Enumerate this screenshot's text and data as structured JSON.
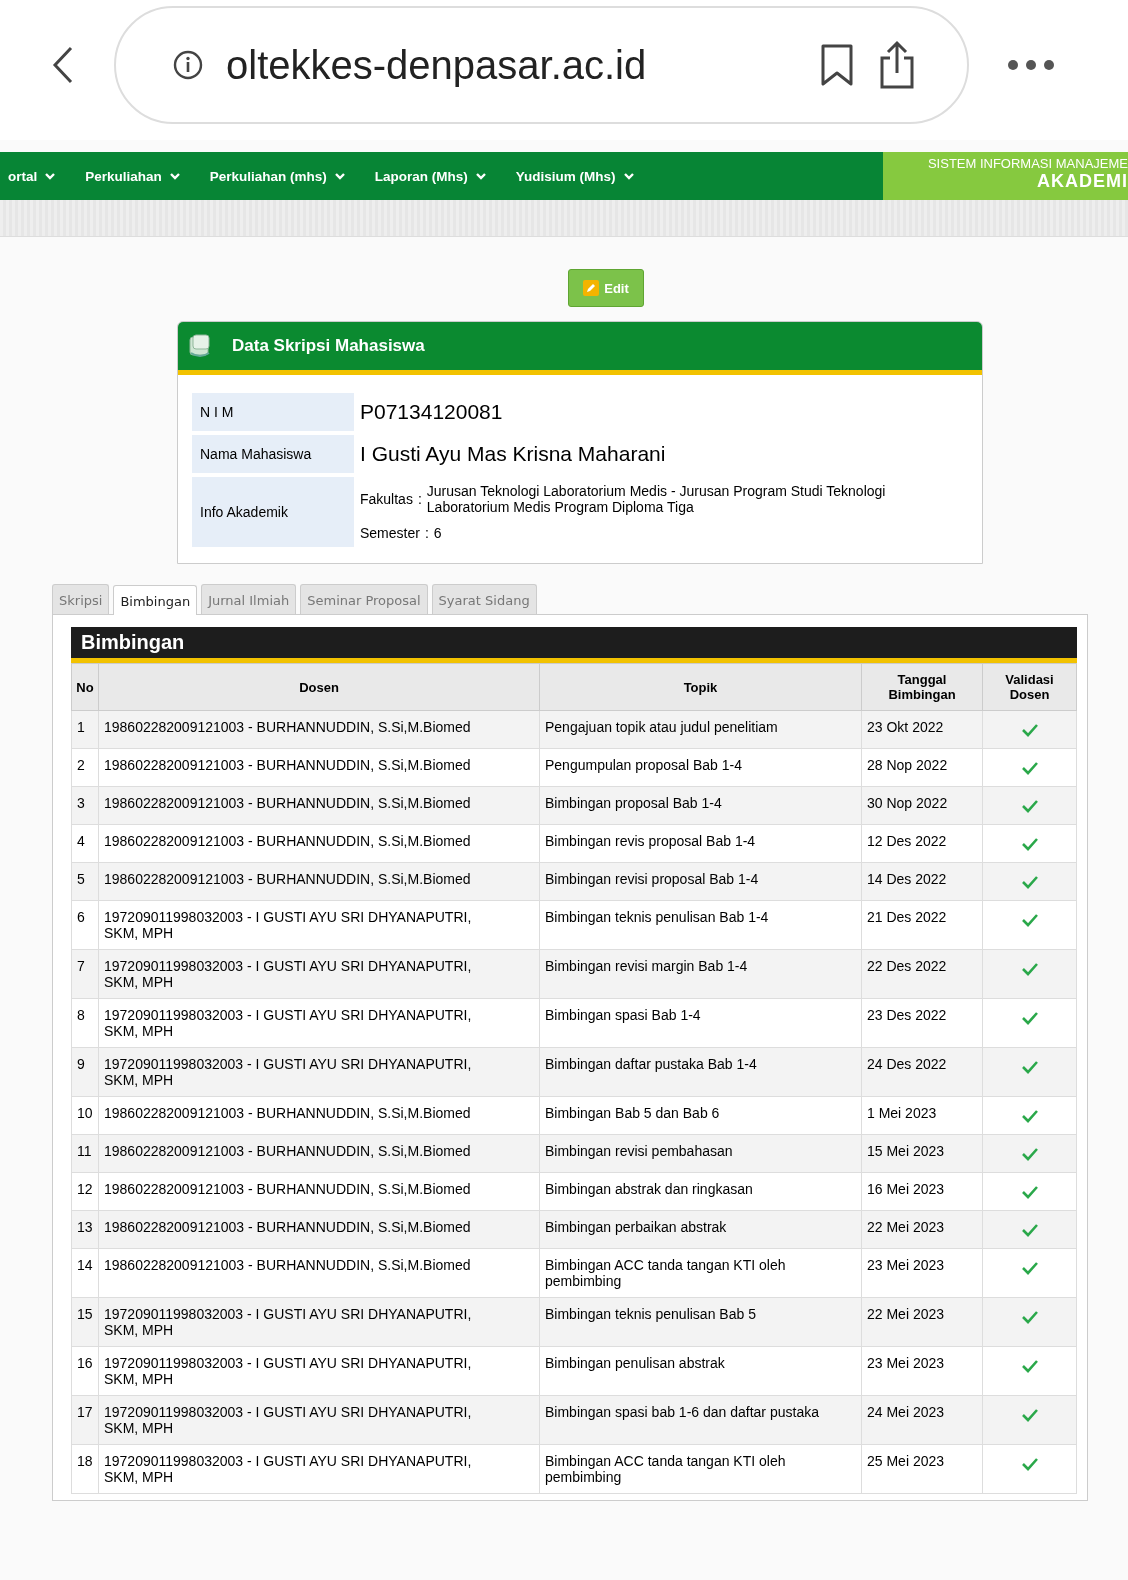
{
  "browser": {
    "url": "oltekkes-denpasar.ac.id"
  },
  "nav": {
    "items": [
      "ortal",
      "Perkuliahan",
      "Perkuliahan (mhs)",
      "Laporan (Mhs)",
      "Yudisium (Mhs)"
    ],
    "logo_top": "SISTEM INFORMASI MANAJEME",
    "logo_bottom": "AKADEMI"
  },
  "edit_button": "Edit",
  "card": {
    "title": "Data Skripsi Mahasiswa",
    "nim_label": "N I M",
    "nim": "P07134120081",
    "name_label": "Nama Mahasiswa",
    "name": "I Gusti Ayu Mas Krisna Maharani",
    "info_label": "Info Akademik",
    "fakultas_label": "Fakultas",
    "fakultas_sep": ":",
    "fakultas": "Jurusan Teknologi Laboratorium Medis - Jurusan Program Studi Teknologi Laboratorium Medis Program Diploma Tiga",
    "semester_label": "Semester",
    "semester_sep": ":",
    "semester": "6"
  },
  "tabs": [
    {
      "label": "Skripsi",
      "selected": false
    },
    {
      "label": "Bimbingan",
      "selected": true
    },
    {
      "label": "Jurnal Ilmiah",
      "selected": false
    },
    {
      "label": "Seminar Proposal",
      "selected": false
    },
    {
      "label": "Syarat Sidang",
      "selected": false
    }
  ],
  "table": {
    "title": "Bimbingan",
    "columns": [
      "No",
      "Dosen",
      "Topik",
      "Tanggal Bimbingan",
      "Validasi Dosen"
    ],
    "rows": [
      {
        "no": "1",
        "dosen": "198602282009121003 - BURHANNUDDIN, S.Si,M.Biomed",
        "topik": "Pengajuan topik atau judul penelitiam",
        "tanggal": "23 Okt 2022",
        "validated": true
      },
      {
        "no": "2",
        "dosen": "198602282009121003 - BURHANNUDDIN, S.Si,M.Biomed",
        "topik": "Pengumpulan proposal Bab 1-4",
        "tanggal": "28 Nop 2022",
        "validated": true
      },
      {
        "no": "3",
        "dosen": "198602282009121003 - BURHANNUDDIN, S.Si,M.Biomed",
        "topik": "Bimbingan proposal Bab 1-4",
        "tanggal": "30 Nop 2022",
        "validated": true
      },
      {
        "no": "4",
        "dosen": "198602282009121003 - BURHANNUDDIN, S.Si,M.Biomed",
        "topik": "Bimbingan revis proposal Bab 1-4",
        "tanggal": "12 Des 2022",
        "validated": true
      },
      {
        "no": "5",
        "dosen": "198602282009121003 - BURHANNUDDIN, S.Si,M.Biomed",
        "topik": "Bimbingan revisi proposal Bab 1-4",
        "tanggal": "14 Des 2022",
        "validated": true
      },
      {
        "no": "6",
        "dosen": "197209011998032003 - I GUSTI AYU SRI DHYANAPUTRI, SKM, MPH",
        "topik": "Bimbingan teknis penulisan Bab 1-4",
        "tanggal": "21 Des 2022",
        "validated": true
      },
      {
        "no": "7",
        "dosen": "197209011998032003 - I GUSTI AYU SRI DHYANAPUTRI, SKM, MPH",
        "topik": "Bimbingan revisi margin Bab 1-4",
        "tanggal": "22 Des 2022",
        "validated": true
      },
      {
        "no": "8",
        "dosen": "197209011998032003 - I GUSTI AYU SRI DHYANAPUTRI, SKM, MPH",
        "topik": "Bimbingan spasi Bab 1-4",
        "tanggal": "23 Des 2022",
        "validated": true
      },
      {
        "no": "9",
        "dosen": "197209011998032003 - I GUSTI AYU SRI DHYANAPUTRI, SKM, MPH",
        "topik": "Bimbingan daftar pustaka Bab 1-4",
        "tanggal": "24 Des 2022",
        "validated": true
      },
      {
        "no": "10",
        "dosen": "198602282009121003 - BURHANNUDDIN, S.Si,M.Biomed",
        "topik": "Bimbingan Bab 5 dan Bab 6",
        "tanggal": "1 Mei 2023",
        "validated": true
      },
      {
        "no": "11",
        "dosen": "198602282009121003 - BURHANNUDDIN, S.Si,M.Biomed",
        "topik": "Bimbingan revisi pembahasan",
        "tanggal": "15 Mei 2023",
        "validated": true
      },
      {
        "no": "12",
        "dosen": "198602282009121003 - BURHANNUDDIN, S.Si,M.Biomed",
        "topik": "Bimbingan abstrak dan ringkasan",
        "tanggal": "16 Mei 2023",
        "validated": true
      },
      {
        "no": "13",
        "dosen": "198602282009121003 - BURHANNUDDIN, S.Si,M.Biomed",
        "topik": "Bimbingan perbaikan abstrak",
        "tanggal": "22 Mei 2023",
        "validated": true
      },
      {
        "no": "14",
        "dosen": "198602282009121003 - BURHANNUDDIN, S.Si,M.Biomed",
        "topik": "Bimbingan ACC tanda tangan KTI oleh pembimbing",
        "tanggal": "23 Mei 2023",
        "validated": true
      },
      {
        "no": "15",
        "dosen": "197209011998032003 - I GUSTI AYU SRI DHYANAPUTRI, SKM, MPH",
        "topik": "Bimbingan teknis penulisan Bab 5",
        "tanggal": "22 Mei 2023",
        "validated": true
      },
      {
        "no": "16",
        "dosen": "197209011998032003 - I GUSTI AYU SRI DHYANAPUTRI, SKM, MPH",
        "topik": "Bimbingan penulisan abstrak",
        "tanggal": "23 Mei 2023",
        "validated": true
      },
      {
        "no": "17",
        "dosen": "197209011998032003 - I GUSTI AYU SRI DHYANAPUTRI, SKM, MPH",
        "topik": "Bimbingan spasi bab 1-6 dan daftar pustaka",
        "tanggal": "24 Mei 2023",
        "validated": true
      },
      {
        "no": "18",
        "dosen": "197209011998032003 - I GUSTI AYU SRI DHYANAPUTRI, SKM, MPH",
        "topik": "Bimbingan ACC tanda tangan KTI oleh pembimbing",
        "tanggal": "25 Mei 2023",
        "validated": true
      }
    ]
  }
}
